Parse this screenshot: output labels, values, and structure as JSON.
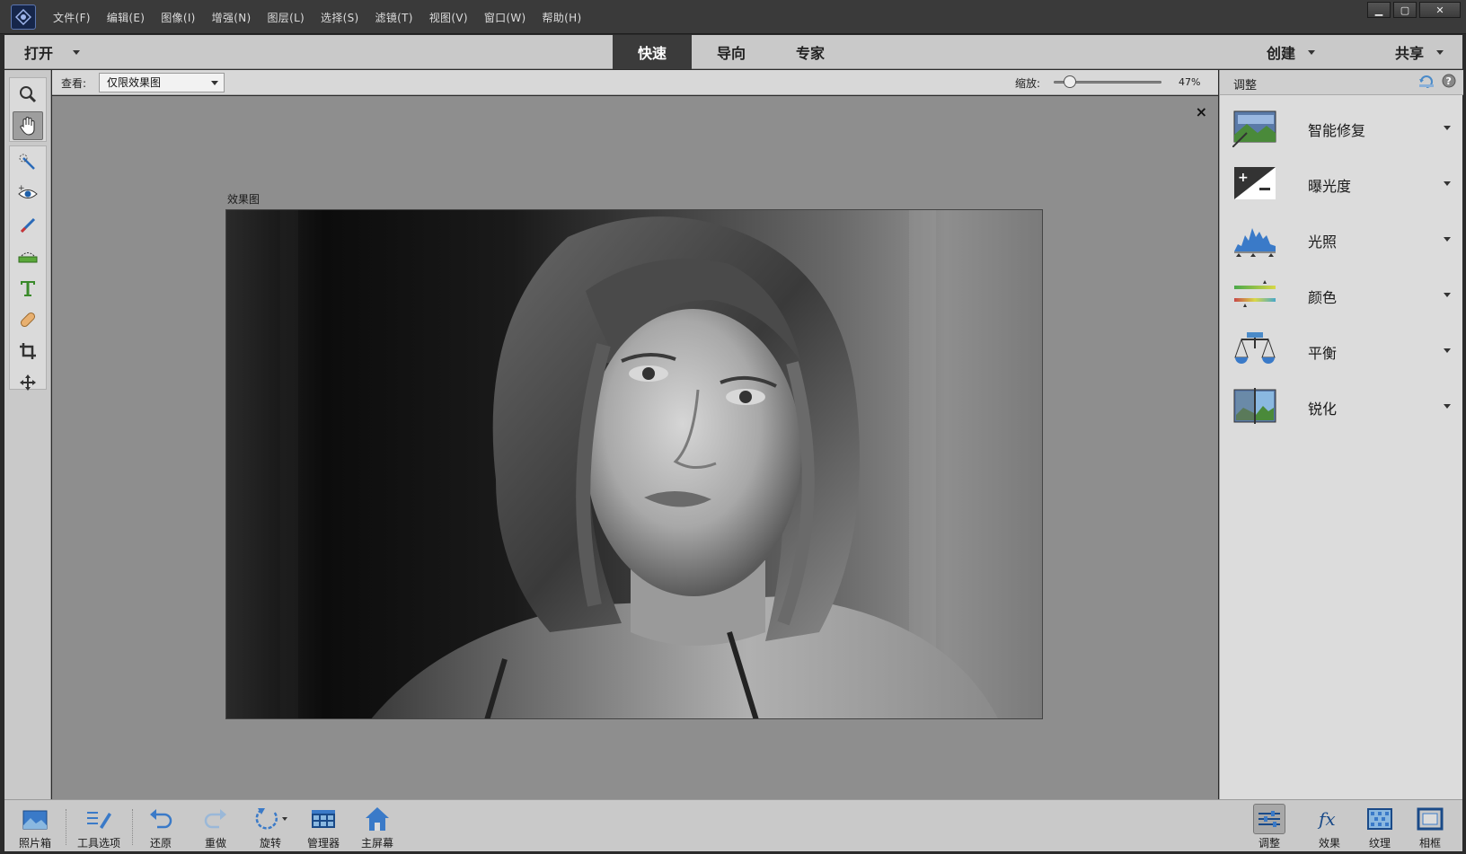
{
  "menu": [
    "文件(F)",
    "编辑(E)",
    "图像(I)",
    "增强(N)",
    "图层(L)",
    "选择(S)",
    "滤镜(T)",
    "视图(V)",
    "窗口(W)",
    "帮助(H)"
  ],
  "window_controls": {
    "minimize": "▁",
    "maximize": "▢",
    "close": "✕"
  },
  "modebar": {
    "open": "打开",
    "tabs": [
      {
        "label": "快速",
        "active": true
      },
      {
        "label": "导向",
        "active": false
      },
      {
        "label": "专家",
        "active": false
      }
    ],
    "create": "创建",
    "share": "共享"
  },
  "tools": [
    "zoom-tool",
    "hand-tool",
    "quick-selection-tool",
    "red-eye-tool",
    "whiten-teeth-tool",
    "straighten-tool",
    "text-tool",
    "spot-healing-tool",
    "crop-tool",
    "move-tool"
  ],
  "options": {
    "view_label": "查看:",
    "view_value": "仅限效果图",
    "zoom_label": "缩放:",
    "zoom_value": "47%",
    "zoom_fraction": 0.15
  },
  "canvas": {
    "caption": "效果图",
    "close": "×"
  },
  "panel": {
    "title": "调整",
    "items": [
      {
        "label": "智能修复",
        "icon": "smart-fix-icon"
      },
      {
        "label": "曝光度",
        "icon": "exposure-icon"
      },
      {
        "label": "光照",
        "icon": "lighting-icon"
      },
      {
        "label": "颜色",
        "icon": "color-icon"
      },
      {
        "label": "平衡",
        "icon": "balance-icon"
      },
      {
        "label": "锐化",
        "icon": "sharpen-icon"
      }
    ]
  },
  "bottom": {
    "photo_bin": "照片箱",
    "tool_options": "工具选项",
    "undo": "还原",
    "redo": "重做",
    "rotate": "旋转",
    "organizer": "管理器",
    "home": "主屏幕",
    "adjustments": "调整",
    "effects": "效果",
    "textures": "纹理",
    "frames": "相框"
  }
}
